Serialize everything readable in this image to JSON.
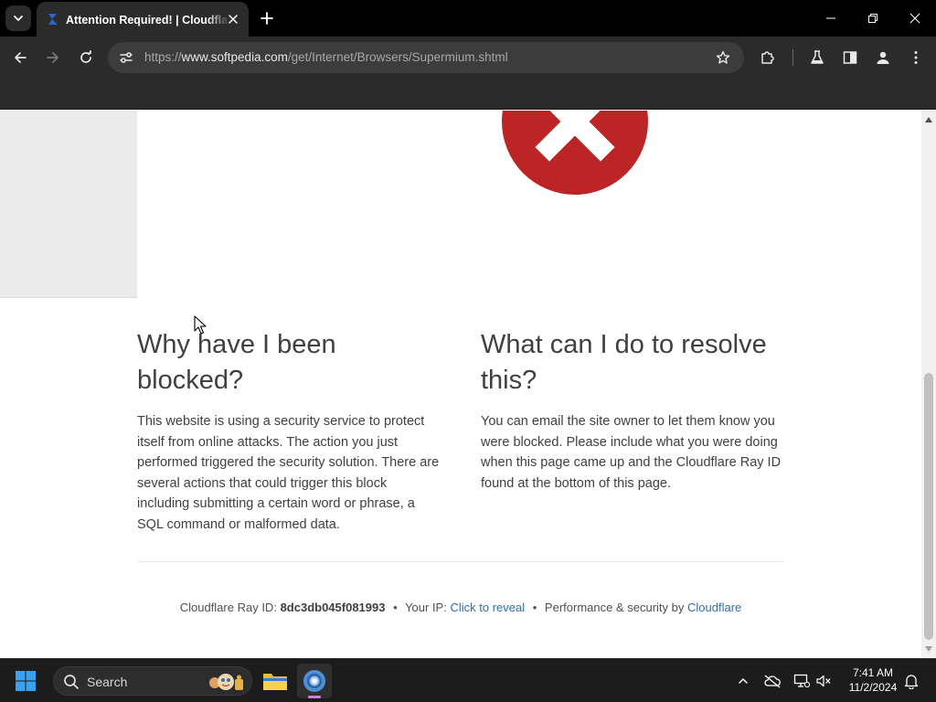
{
  "browser": {
    "tab": {
      "title": "Attention Required! | Cloudflare"
    },
    "address_bar": {
      "scheme": "https://",
      "host": "www.softpedia.com",
      "path": "/get/Internet/Browsers/Supermium.shtml"
    }
  },
  "page": {
    "left_section": {
      "heading": "Why have I been blocked?",
      "body": "This website is using a security service to protect itself from online attacks. The action you just performed triggered the security solution. There are several actions that could trigger this block including submitting a certain word or phrase, a SQL command or malformed data."
    },
    "right_section": {
      "heading": "What can I do to resolve this?",
      "body": "You can email the site owner to let them know you were blocked. Please include what you were doing when this page came up and the Cloudflare Ray ID found at the bottom of this page."
    },
    "footer": {
      "ray_label": "Cloudflare Ray ID:",
      "ray_id": "8dc3db045f081993",
      "separator": "•",
      "ip_label": "Your IP:",
      "ip_link": "Click to reveal",
      "perf_label": "Performance & security by",
      "perf_link": "Cloudflare"
    }
  },
  "taskbar": {
    "search_label": "Search",
    "time": "7:41 AM",
    "date": "11/2/2024"
  },
  "colors": {
    "error_red": "#bd2426",
    "link_blue": "#2f6ea8",
    "text_gray": "#404040"
  },
  "icons": {
    "tab_search": "chevron-down-icon",
    "favicon": "cloudflare-favicon-icon",
    "tab_close": "close-icon",
    "new_tab": "plus-icon",
    "back": "back-arrow-icon",
    "forward": "forward-arrow-icon",
    "reload": "reload-icon",
    "site_info": "tune-icon",
    "bookmark": "star-icon",
    "extensions": "puzzle-icon",
    "labs": "flask-icon",
    "side_panel": "side-panel-icon",
    "profile": "person-icon",
    "menu": "kebab-menu-icon"
  }
}
